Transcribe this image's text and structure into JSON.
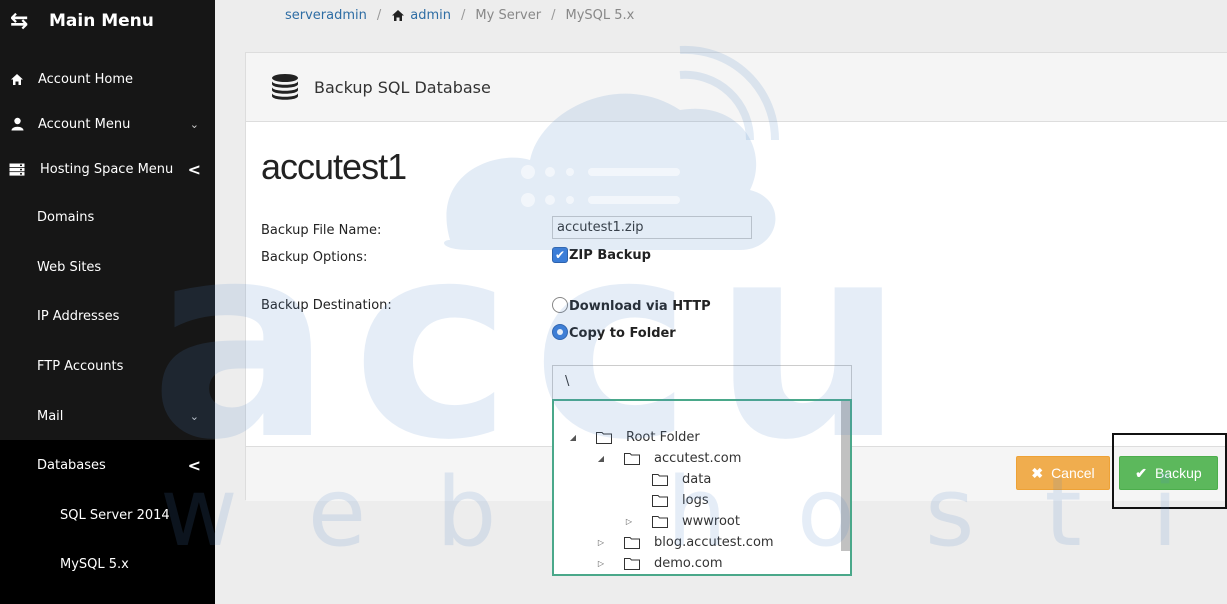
{
  "sidebar": {
    "title": "Main Menu",
    "items": [
      {
        "label": "Account Home"
      },
      {
        "label": "Account Menu"
      },
      {
        "label": "Hosting Space Menu"
      },
      {
        "label": "Domains"
      },
      {
        "label": "Web Sites"
      },
      {
        "label": "IP Addresses"
      },
      {
        "label": "FTP Accounts"
      },
      {
        "label": "Mail"
      },
      {
        "label": "Databases"
      },
      {
        "label": "SQL Server 2014"
      },
      {
        "label": "MySQL 5.x"
      }
    ]
  },
  "breadcrumb": {
    "items": [
      "serveradmin",
      "admin",
      "My Server",
      "MySQL 5.x"
    ],
    "separator": "/"
  },
  "panel": {
    "title": "Backup SQL Database",
    "account_name": "accutest1"
  },
  "form": {
    "file_name_label": "Backup File Name:",
    "file_name_value": "accutest1.zip",
    "options_label": "Backup Options:",
    "zip_backup_label": "ZIP Backup",
    "zip_backup_checked": true,
    "destination_label": "Backup Destination:",
    "download_http_label": "Download via HTTP",
    "copy_folder_label": "Copy to Folder",
    "selected_destination": "Copy to Folder",
    "folder_path": "\\"
  },
  "tree": {
    "nodes": [
      {
        "name": "Root Folder",
        "toggle": "◢"
      },
      {
        "name": "accutest.com",
        "toggle": "◢"
      },
      {
        "name": "data",
        "toggle": ""
      },
      {
        "name": "logs",
        "toggle": ""
      },
      {
        "name": "wwwroot",
        "toggle": "▷"
      },
      {
        "name": "blog.accutest.com",
        "toggle": "▷"
      },
      {
        "name": "demo.com",
        "toggle": "▷"
      }
    ]
  },
  "buttons": {
    "cancel_label": "Cancel",
    "backup_label": "Backup"
  },
  "watermark": {
    "brand": "accu",
    "tagline": "web hosting"
  },
  "colors": {
    "sidebar_bg": "#161616",
    "cancel": "#f0ad4e",
    "backup": "#5cb85c",
    "link": "#2e6da4",
    "tree_border": "#4aa88a",
    "watermark": "#4f86c6"
  }
}
